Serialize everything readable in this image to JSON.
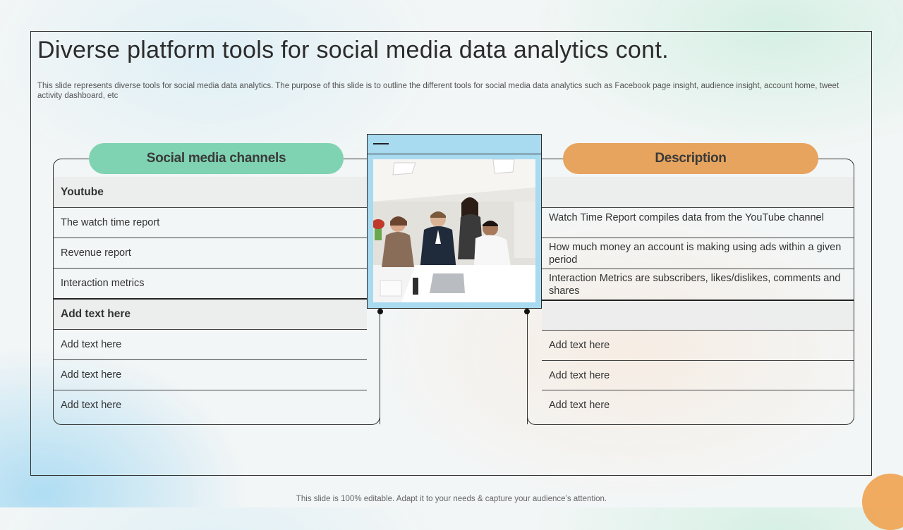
{
  "slide": {
    "title": "Diverse platform tools for social media data analytics cont.",
    "subtitle": "This slide represents diverse tools for social media data analytics. The purpose of this slide is to outline the different tools for social media data analytics such as Facebook page insight, audience insight, account home, tweet activity  dashboard, etc",
    "footer": "This slide is 100% editable. Adapt it to your needs & capture your audience’s attention."
  },
  "left": {
    "header": "Social media channels",
    "rows": [
      "Youtube",
      "The watch time report",
      "Revenue report",
      "Interaction metrics",
      "Add text here",
      "Add text here",
      "Add text here",
      "Add text here"
    ]
  },
  "right": {
    "header": "Description",
    "rows": [
      "",
      "Watch Time Report compiles data from the YouTube channel",
      "How much money an account is making using ads within a given period",
      "Interaction Metrics are subscribers, likes/dislikes, comments and shares",
      "",
      "Add text here",
      "Add text here",
      "Add text here"
    ]
  },
  "colors": {
    "green_pill": "#7fd3b2",
    "orange_pill": "#e7a45e",
    "image_frame": "#a8daf0"
  },
  "icons": {
    "window_header": "minimize-dash-icon"
  }
}
